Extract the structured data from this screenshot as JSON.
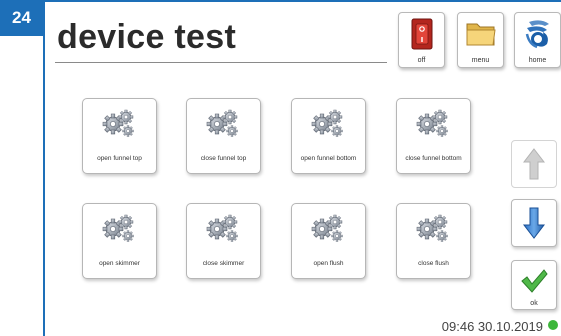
{
  "page_number": "24",
  "header": {
    "title": "device test"
  },
  "top_buttons": [
    {
      "label": "off",
      "icon": "power-switch-icon"
    },
    {
      "label": "menu",
      "icon": "folder-icon"
    },
    {
      "label": "home",
      "icon": "home-logo-icon"
    }
  ],
  "functions": [
    {
      "label": "open funnel top",
      "icon": "gears-icon"
    },
    {
      "label": "close funnel top",
      "icon": "gears-icon"
    },
    {
      "label": "open funnel bottom",
      "icon": "gears-icon"
    },
    {
      "label": "close funnel bottom",
      "icon": "gears-icon"
    },
    {
      "label": "open skimmer",
      "icon": "gears-icon"
    },
    {
      "label": "close skimmer",
      "icon": "gears-icon"
    },
    {
      "label": "open flush",
      "icon": "gears-icon"
    },
    {
      "label": "close flush",
      "icon": "gears-icon"
    }
  ],
  "side_buttons": {
    "up": {
      "icon": "arrow-up-icon",
      "enabled": false
    },
    "down": {
      "icon": "arrow-down-icon",
      "enabled": true
    },
    "ok": {
      "label": "ok",
      "icon": "checkmark-icon"
    }
  },
  "status": {
    "datetime": "09:46 30.10.2019",
    "indicator_color": "#3db63a"
  },
  "colors": {
    "accent": "#1d6fb8"
  }
}
